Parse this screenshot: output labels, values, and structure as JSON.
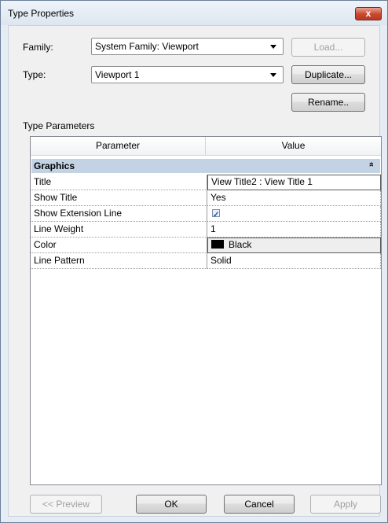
{
  "window": {
    "title": "Type Properties",
    "close_glyph": "x"
  },
  "family": {
    "label": "Family:",
    "value": "System Family: Viewport",
    "load_label": "Load..."
  },
  "type": {
    "label": "Type:",
    "value": "Viewport 1",
    "duplicate_label": "Duplicate...",
    "rename_label": "Rename.."
  },
  "params": {
    "section_label": "Type Parameters",
    "col_parameter": "Parameter",
    "col_value": "Value",
    "group": {
      "label": "Graphics",
      "collapse_glyph": "»"
    },
    "rows": [
      {
        "name": "Title",
        "value": "View Title2 : View Title 1"
      },
      {
        "name": "Show Title",
        "value": "Yes"
      },
      {
        "name": "Show Extension Line",
        "checked": true,
        "check_glyph": "✓"
      },
      {
        "name": "Line Weight",
        "value": "1"
      },
      {
        "name": "Color",
        "value": "Black",
        "swatch_color": "#000000"
      },
      {
        "name": "Line Pattern",
        "value": "Solid"
      }
    ]
  },
  "footer": {
    "preview_label": "<< Preview",
    "ok_label": "OK",
    "cancel_label": "Cancel",
    "apply_label": "Apply"
  }
}
